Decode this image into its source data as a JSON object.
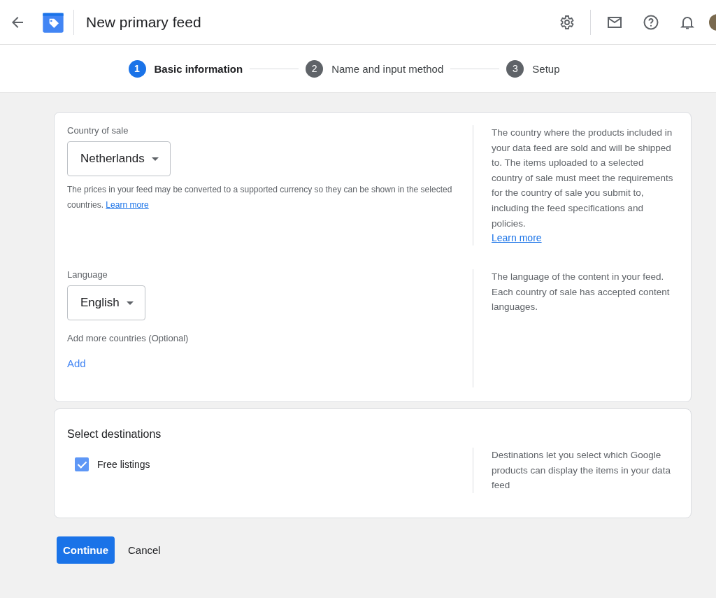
{
  "header": {
    "title": "New primary feed"
  },
  "steps": [
    {
      "number": "1",
      "label": "Basic information",
      "selected": true
    },
    {
      "number": "2",
      "label": "Name and input method",
      "selected": false
    },
    {
      "number": "3",
      "label": "Setup",
      "selected": false
    }
  ],
  "country": {
    "label": "Country of sale",
    "value": "Netherlands",
    "note": "The prices in your feed may be converted to a supported currency so they can be shown in the selected countries.",
    "note_link": "Learn more",
    "help": "The country where the products included in your data feed are sold and will be shipped to. The items uploaded to a selected country of sale must meet the requirements for the country of sale you submit to, including the feed specifications and policies.",
    "help_link": "Learn more"
  },
  "language": {
    "label": "Language",
    "value": "English",
    "help": "The language of the content in your feed. Each country of sale has accepted content languages."
  },
  "add_countries": {
    "label": "Add more countries (Optional)",
    "action": "Add"
  },
  "destinations": {
    "title": "Select destinations",
    "options": [
      {
        "label": "Free listings",
        "checked": true
      }
    ],
    "help": "Destinations let you select which Google products can display the items in your data feed"
  },
  "buttons": {
    "primary": "Continue",
    "secondary": "Cancel"
  }
}
